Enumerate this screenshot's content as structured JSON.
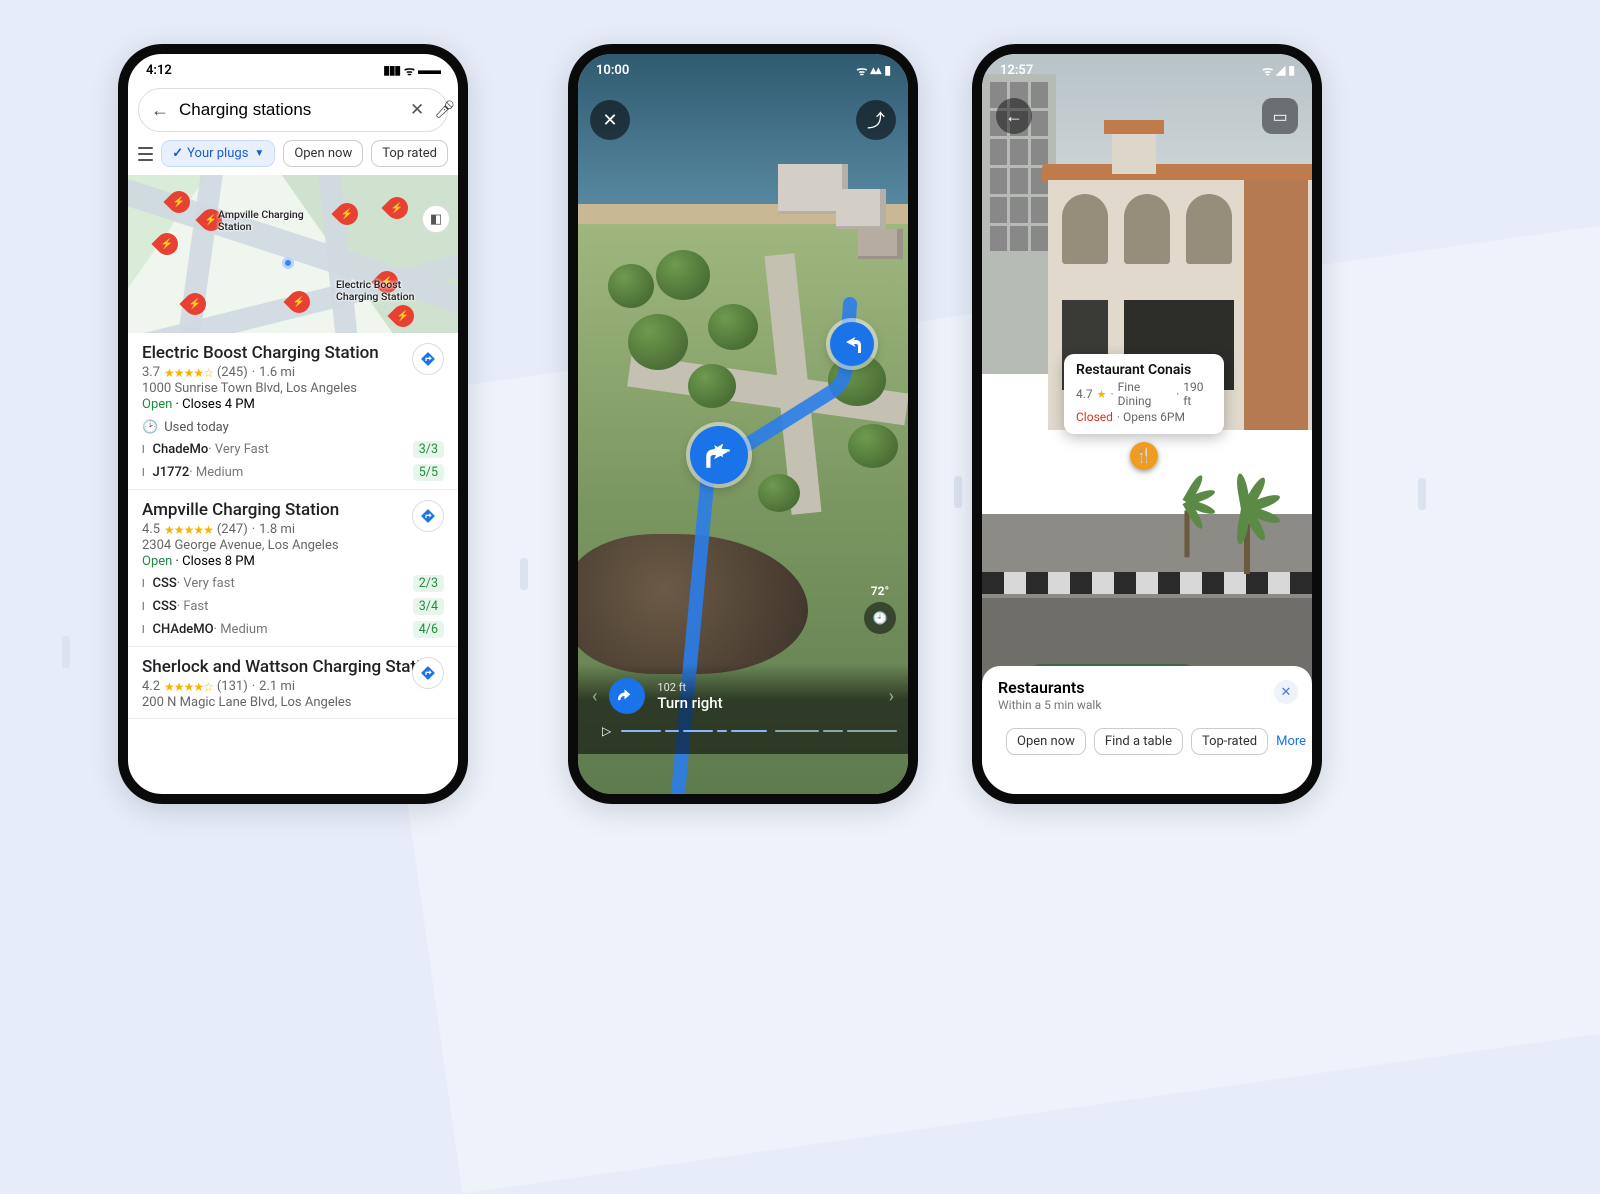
{
  "phone1": {
    "status_time": "4:12",
    "search_value": "Charging stations",
    "chips": {
      "your_plugs": "Your plugs",
      "open_now": "Open now",
      "top_rated": "Top rated"
    },
    "map_labels": {
      "ampville": "Ampville Charging\nStation",
      "eboost": "Electric Boost\nCharging Station"
    },
    "stations": [
      {
        "name": "Electric Boost Charging Station",
        "rating": "3.7",
        "reviews": "(245)",
        "distance": "1.6 mi",
        "address": "1000 Sunrise Town Blvd, Los Angeles",
        "open": "Open",
        "closes": " · Closes 4 PM",
        "used": "Used today",
        "plugs": [
          {
            "type": "ChadeMo",
            "speed": " · Very Fast",
            "avail": "3/3"
          },
          {
            "type": "J1772",
            "speed": " · Medium",
            "avail": "5/5"
          }
        ]
      },
      {
        "name": "Ampville Charging Station",
        "rating": "4.5",
        "reviews": "(247)",
        "distance": "1.8 mi",
        "address": "2304 George Avenue, Los Angeles",
        "open": "Open",
        "closes": " · Closes 8 PM",
        "plugs": [
          {
            "type": "CSS",
            "speed": " · Very fast",
            "avail": "2/3"
          },
          {
            "type": "CSS",
            "speed": " · Fast",
            "avail": "3/4"
          },
          {
            "type": "CHAdeMO",
            "speed": " · Medium",
            "avail": "4/6"
          }
        ]
      },
      {
        "name": "Sherlock and Wattson Charging Station",
        "rating": "4.2",
        "reviews": "(131)",
        "distance": "2.1 mi",
        "address": "200 N Magic Lane Blvd, Los Angeles"
      }
    ]
  },
  "phone2": {
    "status_time": "10:00",
    "temp": "72°",
    "nav": {
      "distance": "102 ft",
      "instruction": "Turn right"
    }
  },
  "phone3": {
    "status_time": "12:57",
    "place": {
      "name": "Restaurant Conais",
      "rating": "4.7",
      "category": "Fine Dining",
      "distance": "190 ft",
      "closed": "Closed",
      "opens": " · Opens 6PM"
    },
    "sheet": {
      "title": "Restaurants",
      "subtitle": "Within a 5 min walk",
      "chips": {
        "open_now": "Open now",
        "find_table": "Find a table",
        "top_rated": "Top-rated",
        "more": "More"
      }
    }
  }
}
